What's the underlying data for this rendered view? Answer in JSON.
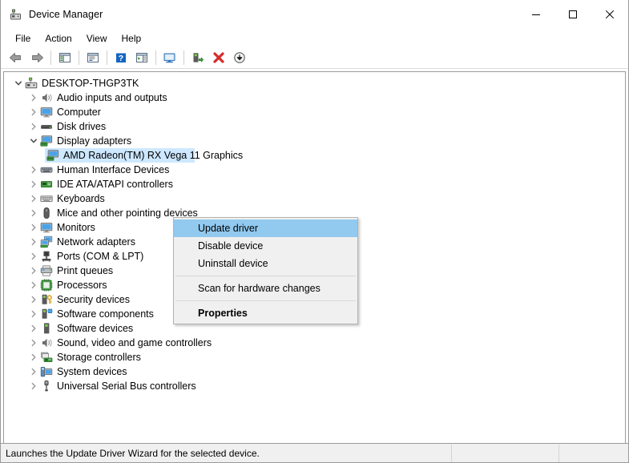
{
  "window": {
    "title": "Device Manager",
    "app_icon": "device-manager-icon",
    "controls": {
      "minimize": "minimize-icon",
      "maximize": "maximize-icon",
      "close": "close-icon"
    }
  },
  "menubar": {
    "items": [
      {
        "label": "File"
      },
      {
        "label": "Action"
      },
      {
        "label": "View"
      },
      {
        "label": "Help"
      }
    ]
  },
  "toolbar": {
    "buttons": [
      {
        "name": "back-arrow-icon",
        "tooltip": "Back"
      },
      {
        "name": "forward-arrow-icon",
        "tooltip": "Forward"
      },
      {
        "name": "show-hide-console-tree-icon",
        "tooltip": "Show/Hide Console Tree"
      },
      {
        "name": "properties-icon",
        "tooltip": "Properties"
      },
      {
        "name": "help-icon",
        "tooltip": "Help"
      },
      {
        "name": "show-hide-action-pane-icon",
        "tooltip": "Show/Hide Action Pane"
      },
      {
        "name": "scan-for-hardware-changes-icon",
        "tooltip": "Scan for hardware changes"
      },
      {
        "name": "update-driver-icon",
        "tooltip": "Update driver"
      },
      {
        "name": "uninstall-device-icon",
        "tooltip": "Uninstall device"
      },
      {
        "name": "disable-device-icon",
        "tooltip": "Disable device"
      }
    ]
  },
  "tree": {
    "nodes": [
      {
        "label": "DESKTOP-THGP3TK",
        "level": 0,
        "state": "expanded",
        "icon": "computer-root-icon",
        "selected": false
      },
      {
        "label": "Audio inputs and outputs",
        "level": 1,
        "state": "collapsed",
        "icon": "speaker-icon",
        "selected": false
      },
      {
        "label": "Computer",
        "level": 1,
        "state": "collapsed",
        "icon": "monitor-icon",
        "selected": false
      },
      {
        "label": "Disk drives",
        "level": 1,
        "state": "collapsed",
        "icon": "disk-drive-icon",
        "selected": false
      },
      {
        "label": "Display adapters",
        "level": 1,
        "state": "expanded",
        "icon": "display-adapter-icon",
        "selected": false
      },
      {
        "label": "AMD Radeon(TM) RX Vega 11 Graphics",
        "level": 2,
        "state": "leaf",
        "icon": "display-adapter-icon",
        "selected": true
      },
      {
        "label": "Human Interface Devices",
        "level": 1,
        "state": "collapsed",
        "icon": "hid-icon",
        "selected": false
      },
      {
        "label": "IDE ATA/ATAPI controllers",
        "level": 1,
        "state": "collapsed",
        "icon": "ide-controller-icon",
        "selected": false
      },
      {
        "label": "Keyboards",
        "level": 1,
        "state": "collapsed",
        "icon": "keyboard-icon",
        "selected": false
      },
      {
        "label": "Mice and other pointing devices",
        "level": 1,
        "state": "collapsed",
        "icon": "mouse-icon",
        "selected": false
      },
      {
        "label": "Monitors",
        "level": 1,
        "state": "collapsed",
        "icon": "monitor-icon",
        "selected": false
      },
      {
        "label": "Network adapters",
        "level": 1,
        "state": "collapsed",
        "icon": "network-adapter-icon",
        "selected": false
      },
      {
        "label": "Ports (COM & LPT)",
        "level": 1,
        "state": "collapsed",
        "icon": "port-icon",
        "selected": false
      },
      {
        "label": "Print queues",
        "level": 1,
        "state": "collapsed",
        "icon": "printer-icon",
        "selected": false
      },
      {
        "label": "Processors",
        "level": 1,
        "state": "collapsed",
        "icon": "processor-icon",
        "selected": false
      },
      {
        "label": "Security devices",
        "level": 1,
        "state": "collapsed",
        "icon": "security-device-icon",
        "selected": false
      },
      {
        "label": "Software components",
        "level": 1,
        "state": "collapsed",
        "icon": "software-component-icon",
        "selected": false
      },
      {
        "label": "Software devices",
        "level": 1,
        "state": "collapsed",
        "icon": "software-device-icon",
        "selected": false
      },
      {
        "label": "Sound, video and game controllers",
        "level": 1,
        "state": "collapsed",
        "icon": "speaker-icon",
        "selected": false
      },
      {
        "label": "Storage controllers",
        "level": 1,
        "state": "collapsed",
        "icon": "storage-controller-icon",
        "selected": false
      },
      {
        "label": "System devices",
        "level": 1,
        "state": "collapsed",
        "icon": "system-device-icon",
        "selected": false
      },
      {
        "label": "Universal Serial Bus controllers",
        "level": 1,
        "state": "collapsed",
        "icon": "usb-icon",
        "selected": false
      }
    ]
  },
  "context_menu": {
    "items": [
      {
        "label": "Update driver",
        "highlighted": true,
        "bold": false,
        "separator_after": false
      },
      {
        "label": "Disable device",
        "highlighted": false,
        "bold": false,
        "separator_after": false
      },
      {
        "label": "Uninstall device",
        "highlighted": false,
        "bold": false,
        "separator_after": true
      },
      {
        "label": "Scan for hardware changes",
        "highlighted": false,
        "bold": false,
        "separator_after": true
      },
      {
        "label": "Properties",
        "highlighted": false,
        "bold": true,
        "separator_after": false
      }
    ]
  },
  "statusbar": {
    "text": "Launches the Update Driver Wizard for the selected device."
  },
  "colors": {
    "menu_highlight": "#91c9ef",
    "tree_selection": "#cde8ff",
    "window_bg": "#f0f0f0",
    "menu_bg": "#f1f0f0",
    "border": "#9a9a9a"
  }
}
